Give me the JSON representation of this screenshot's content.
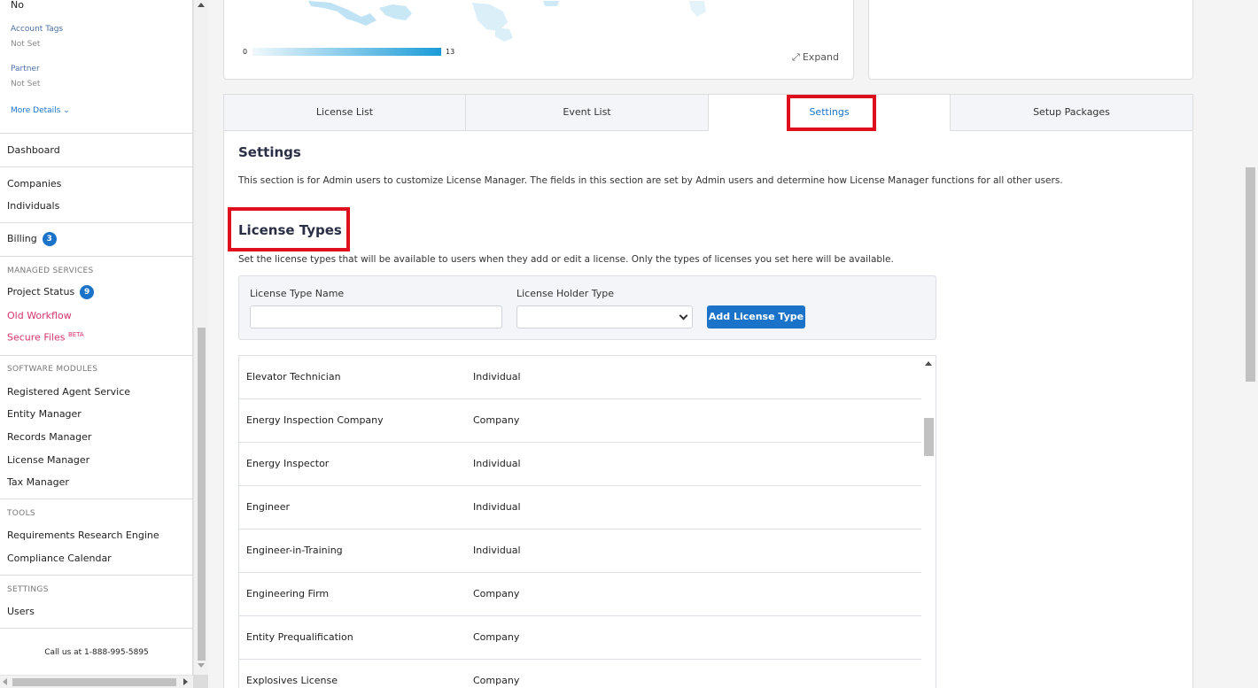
{
  "sidebar": {
    "account_value": "No",
    "account_tags_label": "Account Tags",
    "account_tags_value": "Not Set",
    "partner_label": "Partner",
    "partner_value": "Not Set",
    "more_details": "More Details",
    "dashboard": "Dashboard",
    "companies": "Companies",
    "individuals": "Individuals",
    "billing": "Billing",
    "billing_badge": "3",
    "managed_services_head": "MANAGED SERVICES",
    "project_status": "Project Status",
    "project_status_badge": "9",
    "old_workflow": "Old Workflow",
    "secure_files": "Secure Files",
    "secure_files_sup": "BETA",
    "software_modules_head": "SOFTWARE MODULES",
    "registered_agent": "Registered Agent Service",
    "entity_manager": "Entity Manager",
    "records_manager": "Records Manager",
    "license_manager": "License Manager",
    "tax_manager": "Tax Manager",
    "tools_head": "TOOLS",
    "requirements_engine": "Requirements Research Engine",
    "compliance_calendar": "Compliance Calendar",
    "settings_head": "SETTINGS",
    "users": "Users",
    "call_us": "Call us at 1-888-995-5895"
  },
  "map": {
    "legend_min": "0",
    "legend_max": "13",
    "expand_label": "Expand"
  },
  "tabs": {
    "license_list": "License List",
    "event_list": "Event List",
    "settings": "Settings",
    "setup_packages": "Setup Packages"
  },
  "settings": {
    "title": "Settings",
    "description": "This section is for Admin users to customize License Manager. The fields in this section are set by Admin users and determine how License Manager functions for all other users."
  },
  "license_types": {
    "title": "License Types",
    "description": "Set the license types that will be available to users when they add or edit a license. Only the types of licenses you set here will be available.",
    "name_label": "License Type Name",
    "name_value": "",
    "holder_label": "License Holder Type",
    "holder_value": "",
    "add_button": "Add License Type",
    "rows": [
      {
        "name": "Elevator Technician",
        "holder": "Individual"
      },
      {
        "name": "Energy Inspection Company",
        "holder": "Company"
      },
      {
        "name": "Energy Inspector",
        "holder": "Individual"
      },
      {
        "name": "Engineer",
        "holder": "Individual"
      },
      {
        "name": "Engineer-in-Training",
        "holder": "Individual"
      },
      {
        "name": "Engineering Firm",
        "holder": "Company"
      },
      {
        "name": "Entity Prequalification",
        "holder": "Company"
      },
      {
        "name": "Explosives License",
        "holder": "Company"
      }
    ]
  },
  "colors": {
    "accent": "#1a73c8",
    "highlight": "#e00f1e",
    "link_red": "#d6336c"
  }
}
